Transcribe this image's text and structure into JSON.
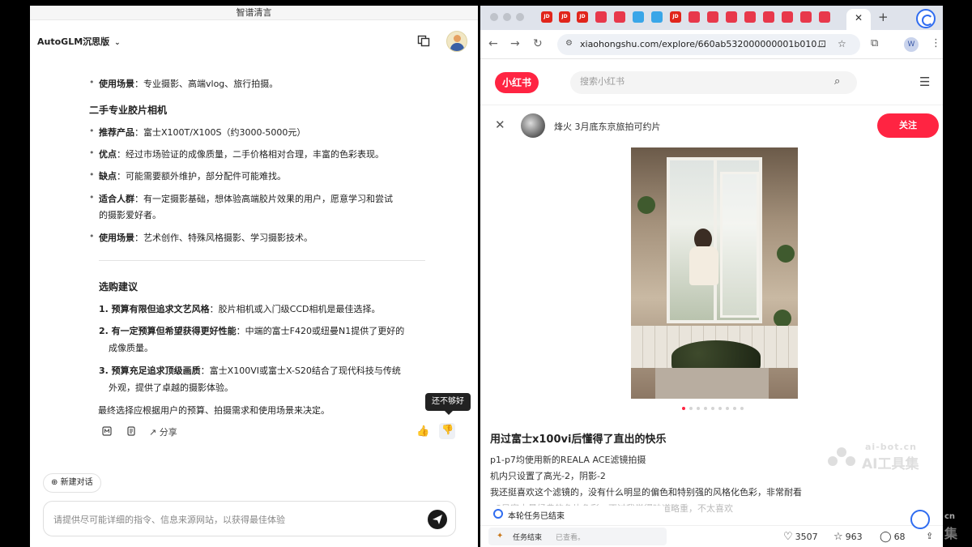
{
  "left": {
    "window_title": "智谱清言",
    "model_name": "AutoGLM沉思版",
    "chat": {
      "usage1_label": "使用场景",
      "usage1_text": "：专业摄影、高端vlog、旅行拍摄。",
      "section_title": "二手专业胶片相机",
      "rec_label": "推荐产品",
      "rec_text": "：富士X100T/X100S（约3000-5000元）",
      "pro_label": "优点",
      "pro_text": "：经过市场验证的成像质量，二手价格相对合理，丰富的色彩表现。",
      "con_label": "缺点",
      "con_text": "：可能需要额外维护，部分配件可能难找。",
      "aud_label": "适合人群",
      "aud_text": "：有一定摄影基础，想体验高端胶片效果的用户，愿意学习和尝试",
      "aud_text2": "的摄影爱好者。",
      "usage2_label": "使用场景",
      "usage2_text": "：艺术创作、特殊风格摄影、学习摄影技术。",
      "advice_title": "选购建议",
      "advice1_label": "1. 预算有限但追求文艺风格",
      "advice1_text": "：胶片相机或入门级CCD相机是最佳选择。",
      "advice2_label": "2. 有一定预算但希望获得更好性能",
      "advice2_text": "：中端的富士F420或纽曼N1提供了更好的",
      "advice2_text2": "成像质量。",
      "advice3_label": "3. 预算充足追求顶级画质",
      "advice3_text": "：富士X100VI或富士X-S20结合了现代科技与传统",
      "advice3_text2": "外观，提供了卓越的摄影体验。",
      "final": "最终选择应根据用户的预算、拍摄需求和使用场景来决定。",
      "share_label": "分享",
      "tooltip": "还不够好"
    },
    "new_chat_label": "新建对话",
    "input_placeholder": "请提供尽可能详细的指令、信息来源网站，以获得最佳体验"
  },
  "browser": {
    "url": "xiaohongshu.com/explore/660ab532000000001b010...",
    "tab_labels": [
      "JD",
      "JD",
      "JD",
      "JD"
    ],
    "profile_initial": "W"
  },
  "xhs": {
    "logo": "小红书",
    "search_placeholder": "搜索小红书",
    "author": "烽火 3月底东京旅拍可约片",
    "follow": "关注",
    "note_title": "用过富士x100vi后懂得了直出的快乐",
    "note_lines": [
      "p1-p7均使用新的REALA ACE滤镜拍摄",
      "机内只设置了高光-2，阴影-2",
      "我还挺喜欢这个滤镜的，没有什么明显的偏色和特别强的风格化色彩，非常耐看",
      "p8是富士最经典的负片色彩，不过我觉得味道略重，不太喜欢"
    ],
    "task_end": "本轮任务已结束",
    "task_status_label": "任务结束",
    "task_status_sub": "已查看。",
    "likes": "3507",
    "collects": "963",
    "comments": "68"
  },
  "watermark": {
    "line1": "ai-bot.cn",
    "line2": "AI工具集",
    "side1": "cn",
    "side2": "集"
  },
  "colors": {
    "xhs_red": "#ff2442",
    "browser_blue": "#2f6cf0"
  }
}
